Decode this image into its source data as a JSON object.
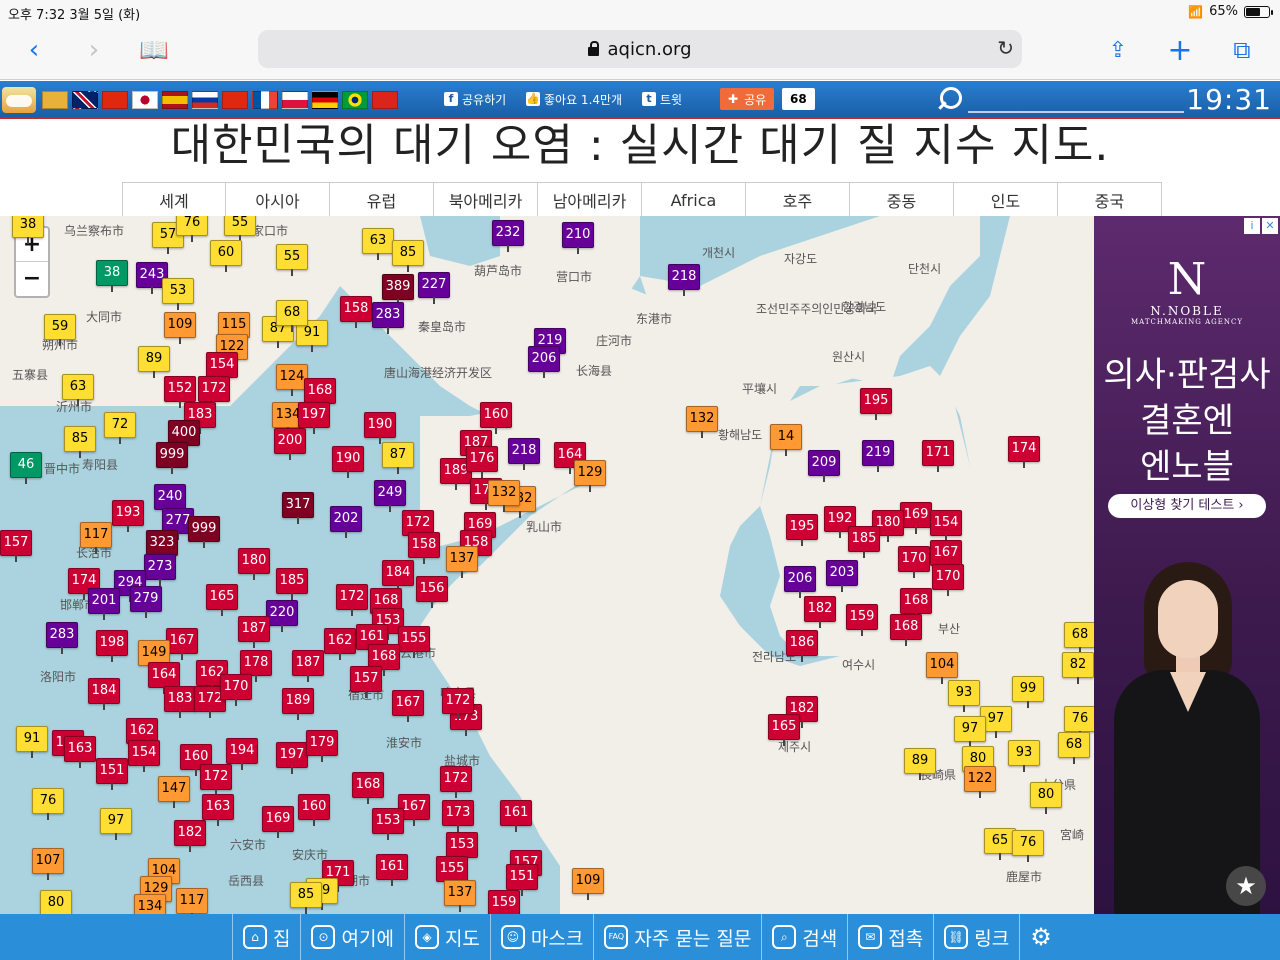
{
  "status_bar": {
    "time_date": "오후 7:32   3월 5일 (화)",
    "battery": "65%",
    "battery_level": 0.65
  },
  "browser": {
    "url": "aqicn.org"
  },
  "site_bar": {
    "share_facebook": "공유하기",
    "like": "좋아요 1.4만개",
    "tweet": "트윗",
    "share": "공유",
    "share_count": "68",
    "clock": "19:31",
    "flags": [
      "flag-cn-region",
      "flag-uk",
      "flag-china",
      "flag-japan",
      "flag-spain",
      "flag-russia",
      "flag-hongkong",
      "flag-france",
      "flag-poland",
      "flag-germany",
      "flag-brazil",
      "flag-vietnam"
    ]
  },
  "page": {
    "title": "대한민국의 대기 오염 : 실시간 대기 질 지수 지도."
  },
  "region_tabs": [
    "세계",
    "아시아",
    "유럽",
    "북아메리카",
    "남아메리카",
    "Africa",
    "호주",
    "중동",
    "인도",
    "중국"
  ],
  "map": {
    "zoom_in": "+",
    "zoom_out": "−",
    "labels": [
      "乌兰察布市",
      "张家口市",
      "大同市",
      "朔州市",
      "五寨县",
      "沂州市",
      "晋中市",
      "寿阳县",
      "长治市",
      "邯郸市",
      "洛阳市",
      "宿迁市",
      "淮安市",
      "盐城市",
      "六安市",
      "安庆市",
      "岳西县",
      "芜湖市",
      "葫芦岛市",
      "营口市",
      "秦皇岛市",
      "唐山海港经济开发区",
      "东港市",
      "庄河市",
      "长海县",
      "乳山市",
      "连云港市",
      "响水县",
      "平壤시",
      "조선민주주의인민공화국",
      "원산시",
      "단천시",
      "자강도",
      "함경남도",
      "개천시",
      "황해남도",
      "전라남도",
      "여수시",
      "제주시",
      "부산",
      "長崎県",
      "鹿屋市",
      "大分県",
      "宮崎"
    ],
    "label_pos": [],
    "markers": [
      {
        "v": "38",
        "c": "y"
      },
      {
        "v": "57",
        "c": "y"
      },
      {
        "v": "76",
        "c": "y"
      },
      {
        "v": "55",
        "c": "y"
      },
      {
        "v": "63",
        "c": "y"
      },
      {
        "v": "85",
        "c": "y"
      },
      {
        "v": "232",
        "c": "p"
      },
      {
        "v": "210",
        "c": "p"
      },
      {
        "v": "60",
        "c": "y"
      },
      {
        "v": "55",
        "c": "y"
      },
      {
        "v": "38",
        "c": "g"
      },
      {
        "v": "243",
        "c": "p"
      },
      {
        "v": "53",
        "c": "y"
      },
      {
        "v": "389",
        "c": "m"
      },
      {
        "v": "227",
        "c": "p"
      },
      {
        "v": "218",
        "c": "p"
      },
      {
        "v": "283",
        "c": "p"
      },
      {
        "v": "158",
        "c": "r"
      },
      {
        "v": "59",
        "c": "y"
      },
      {
        "v": "109",
        "c": "o"
      },
      {
        "v": "115",
        "c": "o"
      },
      {
        "v": "87",
        "c": "y"
      },
      {
        "v": "91",
        "c": "y"
      },
      {
        "v": "68",
        "c": "y"
      },
      {
        "v": "219",
        "c": "p"
      },
      {
        "v": "206",
        "c": "p"
      },
      {
        "v": "89",
        "c": "y"
      },
      {
        "v": "122",
        "c": "o"
      },
      {
        "v": "154",
        "c": "r"
      },
      {
        "v": "124",
        "c": "o"
      },
      {
        "v": "63",
        "c": "y"
      },
      {
        "v": "152",
        "c": "r"
      },
      {
        "v": "172",
        "c": "r"
      },
      {
        "v": "168",
        "c": "r"
      },
      {
        "v": "183",
        "c": "r"
      },
      {
        "v": "134",
        "c": "o"
      },
      {
        "v": "197",
        "c": "r"
      },
      {
        "v": "72",
        "c": "y"
      },
      {
        "v": "85",
        "c": "y"
      },
      {
        "v": "400",
        "c": "m"
      },
      {
        "v": "200",
        "c": "r"
      },
      {
        "v": "190",
        "c": "r"
      },
      {
        "v": "160",
        "c": "r"
      },
      {
        "v": "187",
        "c": "r"
      },
      {
        "v": "218",
        "c": "p"
      },
      {
        "v": "164",
        "c": "r"
      },
      {
        "v": "132",
        "c": "o"
      },
      {
        "v": "46",
        "c": "g"
      },
      {
        "v": "999",
        "c": "m"
      },
      {
        "v": "190",
        "c": "r"
      },
      {
        "v": "87",
        "c": "y"
      },
      {
        "v": "189",
        "c": "r"
      },
      {
        "v": "176",
        "c": "r"
      },
      {
        "v": "129",
        "c": "o"
      },
      {
        "v": "240",
        "c": "p"
      },
      {
        "v": "317",
        "c": "m"
      },
      {
        "v": "249",
        "c": "p"
      },
      {
        "v": "171",
        "c": "r"
      },
      {
        "v": "132",
        "c": "o"
      },
      {
        "v": "193",
        "c": "r"
      },
      {
        "v": "277",
        "c": "p"
      },
      {
        "v": "999",
        "c": "m"
      },
      {
        "v": "202",
        "c": "p"
      },
      {
        "v": "172",
        "c": "r"
      },
      {
        "v": "169",
        "c": "r"
      },
      {
        "v": "117",
        "c": "o"
      },
      {
        "v": "323",
        "c": "m"
      },
      {
        "v": "180",
        "c": "r"
      },
      {
        "v": "158",
        "c": "r"
      },
      {
        "v": "158",
        "c": "r"
      },
      {
        "v": "137",
        "c": "o"
      },
      {
        "v": "157",
        "c": "r"
      },
      {
        "v": "273",
        "c": "p"
      },
      {
        "v": "184",
        "c": "r"
      },
      {
        "v": "174",
        "c": "r"
      },
      {
        "v": "294",
        "c": "p"
      },
      {
        "v": "185",
        "c": "r"
      },
      {
        "v": "156",
        "c": "r"
      },
      {
        "v": "201",
        "c": "p"
      },
      {
        "v": "279",
        "c": "p"
      },
      {
        "v": "165",
        "c": "r"
      },
      {
        "v": "172",
        "c": "r"
      },
      {
        "v": "168",
        "c": "r"
      },
      {
        "v": "220",
        "c": "p"
      },
      {
        "v": "153",
        "c": "r"
      },
      {
        "v": "283",
        "c": "p"
      },
      {
        "v": "198",
        "c": "r"
      },
      {
        "v": "167",
        "c": "r"
      },
      {
        "v": "187",
        "c": "r"
      },
      {
        "v": "162",
        "c": "r"
      },
      {
        "v": "161",
        "c": "r"
      },
      {
        "v": "155",
        "c": "r"
      },
      {
        "v": "149",
        "c": "o"
      },
      {
        "v": "178",
        "c": "r"
      },
      {
        "v": "187",
        "c": "r"
      },
      {
        "v": "168",
        "c": "r"
      },
      {
        "v": "164",
        "c": "r"
      },
      {
        "v": "162",
        "c": "r"
      },
      {
        "v": "157",
        "c": "r"
      },
      {
        "v": "184",
        "c": "r"
      },
      {
        "v": "183",
        "c": "r"
      },
      {
        "v": "172",
        "c": "r"
      },
      {
        "v": "170",
        "c": "r"
      },
      {
        "v": "189",
        "c": "r"
      },
      {
        "v": "167",
        "c": "r"
      },
      {
        "v": "173",
        "c": "r"
      },
      {
        "v": "172",
        "c": "r"
      },
      {
        "v": "91",
        "c": "y"
      },
      {
        "v": "162",
        "c": "r"
      },
      {
        "v": "193",
        "c": "r"
      },
      {
        "v": "154",
        "c": "r"
      },
      {
        "v": "160",
        "c": "r"
      },
      {
        "v": "194",
        "c": "r"
      },
      {
        "v": "197",
        "c": "r"
      },
      {
        "v": "179",
        "c": "r"
      },
      {
        "v": "163",
        "c": "r"
      },
      {
        "v": "151",
        "c": "r"
      },
      {
        "v": "172",
        "c": "r"
      },
      {
        "v": "76",
        "c": "y"
      },
      {
        "v": "147",
        "c": "o"
      },
      {
        "v": "168",
        "c": "r"
      },
      {
        "v": "172",
        "c": "r"
      },
      {
        "v": "97",
        "c": "y"
      },
      {
        "v": "182",
        "c": "r"
      },
      {
        "v": "163",
        "c": "r"
      },
      {
        "v": "169",
        "c": "r"
      },
      {
        "v": "160",
        "c": "r"
      },
      {
        "v": "167",
        "c": "r"
      },
      {
        "v": "153",
        "c": "r"
      },
      {
        "v": "173",
        "c": "r"
      },
      {
        "v": "161",
        "c": "r"
      },
      {
        "v": "153",
        "c": "r"
      },
      {
        "v": "107",
        "c": "o"
      },
      {
        "v": "104",
        "c": "o"
      },
      {
        "v": "171",
        "c": "r"
      },
      {
        "v": "161",
        "c": "r"
      },
      {
        "v": "155",
        "c": "r"
      },
      {
        "v": "157",
        "c": "r"
      },
      {
        "v": "129",
        "c": "o"
      },
      {
        "v": "99",
        "c": "y"
      },
      {
        "v": "151",
        "c": "r"
      },
      {
        "v": "109",
        "c": "o"
      },
      {
        "v": "80",
        "c": "y"
      },
      {
        "v": "134",
        "c": "o"
      },
      {
        "v": "117",
        "c": "o"
      },
      {
        "v": "85",
        "c": "y"
      },
      {
        "v": "137",
        "c": "o"
      },
      {
        "v": "159",
        "c": "r"
      },
      {
        "v": "132",
        "c": "o"
      },
      {
        "v": "195",
        "c": "r"
      },
      {
        "v": "14",
        "c": "o"
      },
      {
        "v": "209",
        "c": "p"
      },
      {
        "v": "219",
        "c": "p"
      },
      {
        "v": "171",
        "c": "r"
      },
      {
        "v": "174",
        "c": "r"
      },
      {
        "v": "169",
        "c": "r"
      },
      {
        "v": "192",
        "c": "r"
      },
      {
        "v": "154",
        "c": "r"
      },
      {
        "v": "195",
        "c": "r"
      },
      {
        "v": "180",
        "c": "r"
      },
      {
        "v": "185",
        "c": "r"
      },
      {
        "v": "170",
        "c": "r"
      },
      {
        "v": "167",
        "c": "r"
      },
      {
        "v": "203",
        "c": "p"
      },
      {
        "v": "206",
        "c": "p"
      },
      {
        "v": "170",
        "c": "r"
      },
      {
        "v": "182",
        "c": "r"
      },
      {
        "v": "168",
        "c": "r"
      },
      {
        "v": "159",
        "c": "r"
      },
      {
        "v": "168",
        "c": "r"
      },
      {
        "v": "186",
        "c": "r"
      },
      {
        "v": "104",
        "c": "o"
      },
      {
        "v": "182",
        "c": "r"
      },
      {
        "v": "165",
        "c": "r"
      },
      {
        "v": "68",
        "c": "y"
      },
      {
        "v": "82",
        "c": "y"
      },
      {
        "v": "93",
        "c": "y"
      },
      {
        "v": "99",
        "c": "y"
      },
      {
        "v": "97",
        "c": "y"
      },
      {
        "v": "97",
        "c": "y"
      },
      {
        "v": "76",
        "c": "y"
      },
      {
        "v": "68",
        "c": "y"
      },
      {
        "v": "89",
        "c": "y"
      },
      {
        "v": "80",
        "c": "y"
      },
      {
        "v": "93",
        "c": "y"
      },
      {
        "v": "122",
        "c": "o"
      },
      {
        "v": "80",
        "c": "y"
      },
      {
        "v": "65",
        "c": "y"
      },
      {
        "v": "76",
        "c": "y"
      }
    ]
  },
  "ad": {
    "brand_mark": "N",
    "brand_name": "N.NOBLE",
    "brand_tagline": "MATCHMAKING AGENCY",
    "headline_1": "의사·판검사",
    "headline_2": "결혼엔",
    "headline_3": "엔노블",
    "cta": "이상형 찾기 테스트 ›"
  },
  "bottom_nav": [
    "집",
    "여기에",
    "지도",
    "마스크",
    "자주 묻는 질문",
    "검색",
    "접촉",
    "링크"
  ],
  "colors": {
    "good": "#009966",
    "moderate": "#ffde33",
    "usg": "#ff9933",
    "unhealthy": "#cc0033",
    "very_unhealthy": "#660099",
    "hazardous": "#7e0023"
  }
}
